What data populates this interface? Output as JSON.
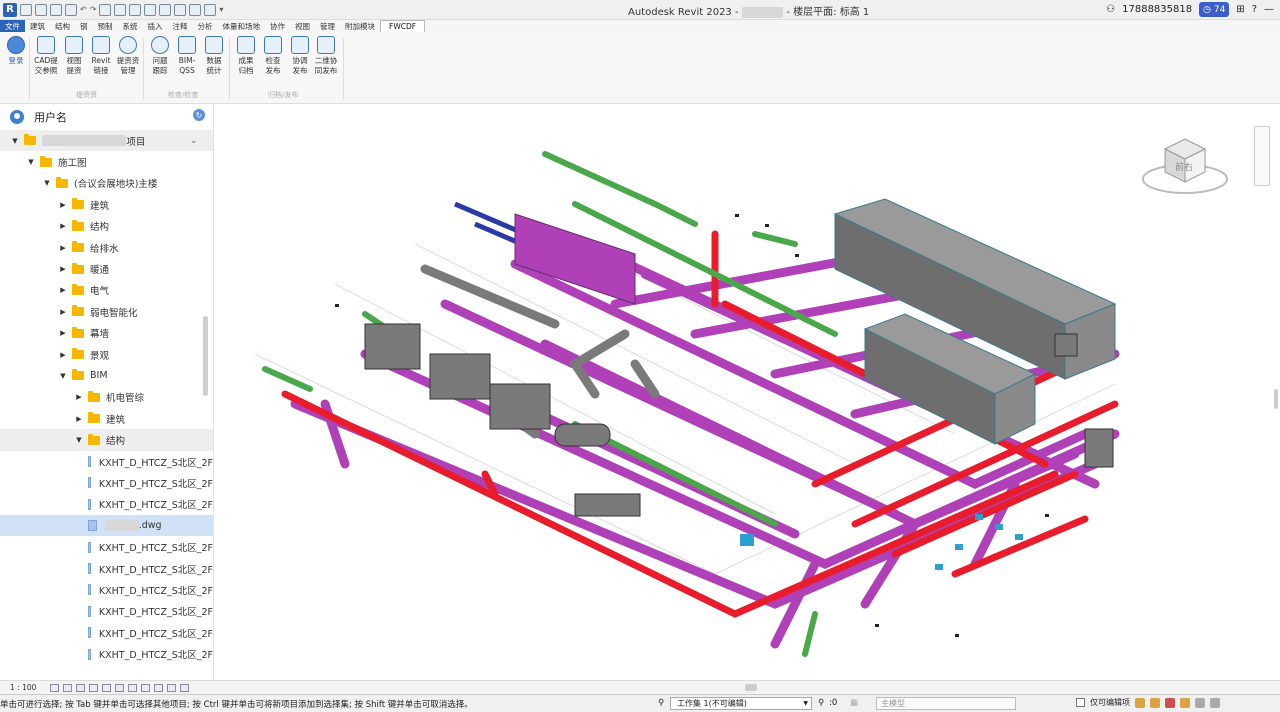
{
  "title_bar": {
    "app_title": "Autodesk Revit 2023 - ",
    "view_title": " - 楼层平面: 标高 1",
    "user": "17888835818",
    "badge": "74"
  },
  "menu_tabs": [
    "文件",
    "建筑",
    "结构",
    "钢",
    "预制",
    "系统",
    "插入",
    "注释",
    "分析",
    "体量和场地",
    "协作",
    "视图",
    "管理",
    "附加模块",
    "FWCDF"
  ],
  "ribbon": {
    "buttons": [
      {
        "label": "登录"
      },
      {
        "label": "CAD提\n交参照"
      },
      {
        "label": "视图\n提资"
      },
      {
        "label": "Revit\n链接"
      },
      {
        "label": "提资资\n管理"
      },
      {
        "label": "问题\n跟踪"
      },
      {
        "label": "BIM-\nQSS"
      },
      {
        "label": "数据\n统计"
      },
      {
        "label": "成果\n归档"
      },
      {
        "label": "检查\n发布"
      },
      {
        "label": "协调\n发布"
      },
      {
        "label": "二维协\n同发布"
      }
    ],
    "groups": [
      "提资资",
      "检查/检查",
      "归档/发布"
    ]
  },
  "sidebar": {
    "user_name": "用户名",
    "tree": [
      {
        "label": "项目",
        "level": 0,
        "type": "folder",
        "open": true,
        "redacted": true
      },
      {
        "label": "施工图",
        "level": 1,
        "type": "folder",
        "open": true
      },
      {
        "label": "(合议会展地块)主楼",
        "level": 2,
        "type": "folder",
        "open": true
      },
      {
        "label": "建筑",
        "level": 3,
        "type": "folder",
        "open": false
      },
      {
        "label": "结构",
        "level": 3,
        "type": "folder",
        "open": false
      },
      {
        "label": "给排水",
        "level": 3,
        "type": "folder",
        "open": false
      },
      {
        "label": "暖通",
        "level": 3,
        "type": "folder",
        "open": false
      },
      {
        "label": "电气",
        "level": 3,
        "type": "folder",
        "open": false
      },
      {
        "label": "弱电智能化",
        "level": 3,
        "type": "folder",
        "open": false
      },
      {
        "label": "幕墙",
        "level": 3,
        "type": "folder",
        "open": false
      },
      {
        "label": "景观",
        "level": 3,
        "type": "folder",
        "open": false
      },
      {
        "label": "BIM",
        "level": 3,
        "type": "folder",
        "open": true
      },
      {
        "label": "机电管综",
        "level": 4,
        "type": "folder",
        "open": false
      },
      {
        "label": "建筑",
        "level": 4,
        "type": "folder",
        "open": false
      },
      {
        "label": "结构",
        "level": 4,
        "type": "folder",
        "open": true,
        "highlight": "light"
      },
      {
        "label": "KXHT_D_HTCZ_S北区_2F",
        "level": 5,
        "type": "file"
      },
      {
        "label": "KXHT_D_HTCZ_S北区_2F",
        "level": 5,
        "type": "file"
      },
      {
        "label": "KXHT_D_HTCZ_S北区_2F",
        "level": 5,
        "type": "file"
      },
      {
        "label": ".dwg",
        "level": 5,
        "type": "file",
        "highlight": "blue",
        "redacted": true
      },
      {
        "label": "KXHT_D_HTCZ_S北区_2F",
        "level": 5,
        "type": "file"
      },
      {
        "label": "KXHT_D_HTCZ_S北区_2F",
        "level": 5,
        "type": "file"
      },
      {
        "label": "KXHT_D_HTCZ_S北区_2F",
        "level": 5,
        "type": "file"
      },
      {
        "label": "KXHT_D_HTCZ_S北区_2F",
        "level": 5,
        "type": "file"
      },
      {
        "label": "KXHT_D_HTCZ_S北区_2F",
        "level": 5,
        "type": "file"
      },
      {
        "label": "KXHT_D_HTCZ_S北区_2F",
        "level": 5,
        "type": "file"
      }
    ]
  },
  "viewcube": {
    "face_label": "前右"
  },
  "view_control": {
    "scale": "1 : 100"
  },
  "status": {
    "hint": "单击可进行选择; 按 Tab 键并单击可选择其他项目; 按 Ctrl 键并单击可将新项目添加到选择集; 按 Shift 键并单击可取消选择。",
    "workset": "工作集 1(不可编辑)",
    "coord": ":0",
    "model": "主模型",
    "editable_only": "仅可编辑项"
  },
  "colors": {
    "accent": "#2a63b8",
    "folder": "#f5b700",
    "duct_magenta": "#b040b8",
    "pipe_red": "#e81c2a",
    "pipe_green": "#4aa84a",
    "equipment_gray": "#8a8a8a"
  }
}
